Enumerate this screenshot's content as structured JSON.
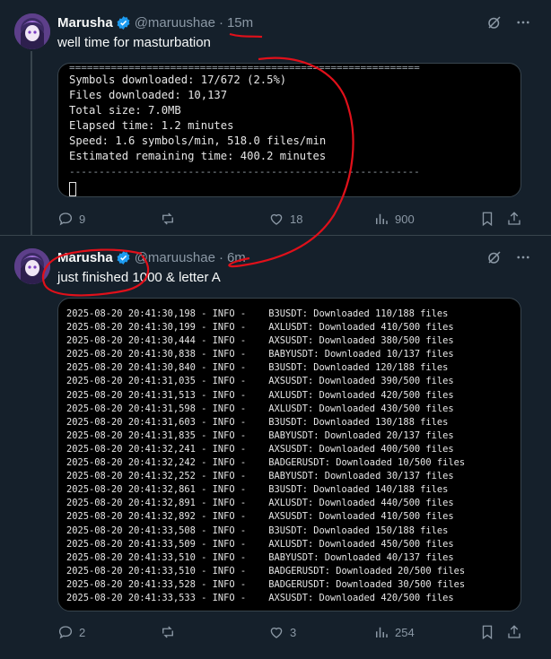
{
  "posts": [
    {
      "name": "Marusha",
      "handle": "@maruushae",
      "dot": "·",
      "time": "15m",
      "text": "well time for masturbation",
      "terminal": {
        "separator_top": "===========================================================",
        "lines": [
          "Symbols downloaded: 17/672 (2.5%)",
          "Files downloaded: 10,137",
          "Total size: 7.0MB",
          "Elapsed time: 1.2 minutes",
          "Speed: 1.6 symbols/min, 518.0 files/min",
          "Estimated remaining time: 400.2 minutes"
        ],
        "separator_bottom": "-----------------------------------------------------------"
      },
      "actions": {
        "replies": "9",
        "reposts": "",
        "likes": "18",
        "views": "900"
      }
    },
    {
      "name": "Marusha",
      "handle": "@maruushae",
      "dot": "·",
      "time": "6m",
      "text": "just finished 1000 & letter A",
      "log": [
        "2025-08-20 20:41:30,198 - INFO -    B3USDT: Downloaded 110/188 files",
        "2025-08-20 20:41:30,199 - INFO -    AXLUSDT: Downloaded 410/500 files",
        "2025-08-20 20:41:30,444 - INFO -    AXSUSDT: Downloaded 380/500 files",
        "2025-08-20 20:41:30,838 - INFO -    BABYUSDT: Downloaded 10/137 files",
        "2025-08-20 20:41:30,840 - INFO -    B3USDT: Downloaded 120/188 files",
        "2025-08-20 20:41:31,035 - INFO -    AXSUSDT: Downloaded 390/500 files",
        "2025-08-20 20:41:31,513 - INFO -    AXLUSDT: Downloaded 420/500 files",
        "2025-08-20 20:41:31,598 - INFO -    AXLUSDT: Downloaded 430/500 files",
        "2025-08-20 20:41:31,603 - INFO -    B3USDT: Downloaded 130/188 files",
        "2025-08-20 20:41:31,835 - INFO -    BABYUSDT: Downloaded 20/137 files",
        "2025-08-20 20:41:32,241 - INFO -    AXSUSDT: Downloaded 400/500 files",
        "2025-08-20 20:41:32,242 - INFO -    BADGERUSDT: Downloaded 10/500 files",
        "2025-08-20 20:41:32,252 - INFO -    BABYUSDT: Downloaded 30/137 files",
        "2025-08-20 20:41:32,861 - INFO -    B3USDT: Downloaded 140/188 files",
        "2025-08-20 20:41:32,891 - INFO -    AXLUSDT: Downloaded 440/500 files",
        "2025-08-20 20:41:32,892 - INFO -    AXSUSDT: Downloaded 410/500 files",
        "2025-08-20 20:41:33,508 - INFO -    B3USDT: Downloaded 150/188 files",
        "2025-08-20 20:41:33,509 - INFO -    AXLUSDT: Downloaded 450/500 files",
        "2025-08-20 20:41:33,510 - INFO -    BABYUSDT: Downloaded 40/137 files",
        "2025-08-20 20:41:33,510 - INFO -    BADGERUSDT: Downloaded 20/500 files",
        "2025-08-20 20:41:33,528 - INFO -    BADGERUSDT: Downloaded 30/500 files",
        "2025-08-20 20:41:33,533 - INFO -    AXSUSDT: Downloaded 420/500 files"
      ],
      "actions": {
        "replies": "2",
        "reposts": "",
        "likes": "3",
        "views": "254"
      }
    }
  ],
  "colors": {
    "background": "#15202b",
    "muted": "#8b98a5",
    "verified": "#1d9bf0",
    "annotation": "#e0101a"
  }
}
